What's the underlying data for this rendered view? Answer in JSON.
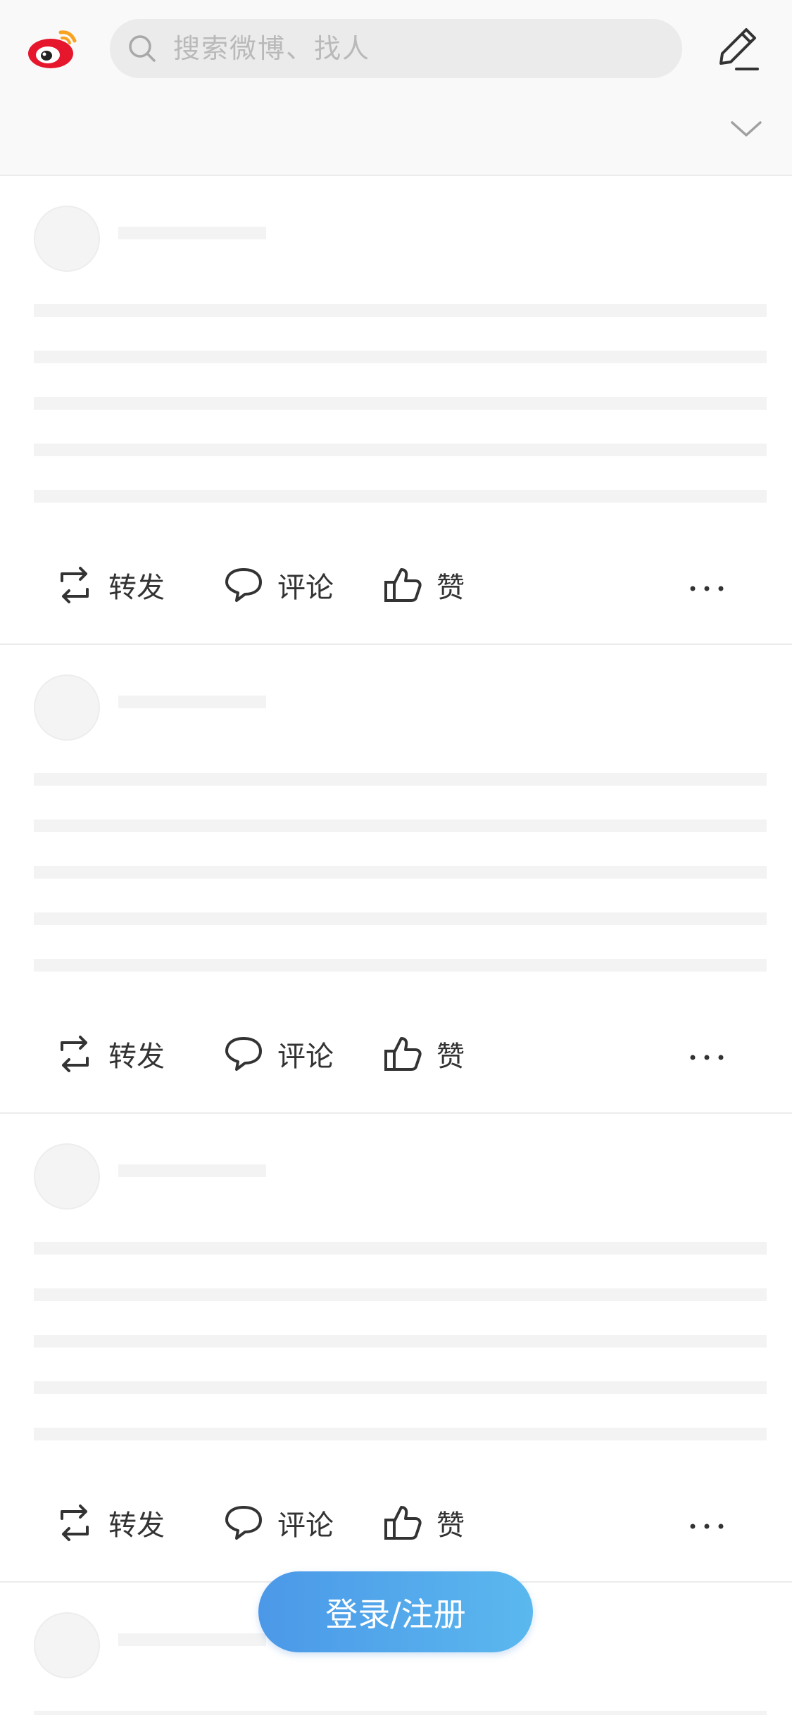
{
  "header": {
    "logo_icon": "weibo-logo-icon",
    "search_placeholder": "搜索微博、找人",
    "search_icon": "search-icon",
    "compose_icon": "edit-pencil-icon",
    "expand_icon": "chevron-down-icon"
  },
  "actions": {
    "repost_label": "转发",
    "comment_label": "评论",
    "like_label": "赞",
    "more_icon": "more-dots-icon"
  },
  "login_button": {
    "label": "登录/注册"
  },
  "colors": {
    "brand_red": "#e6162d",
    "accent_blue": "#4b98e8",
    "placeholder": "#ebebeb"
  }
}
